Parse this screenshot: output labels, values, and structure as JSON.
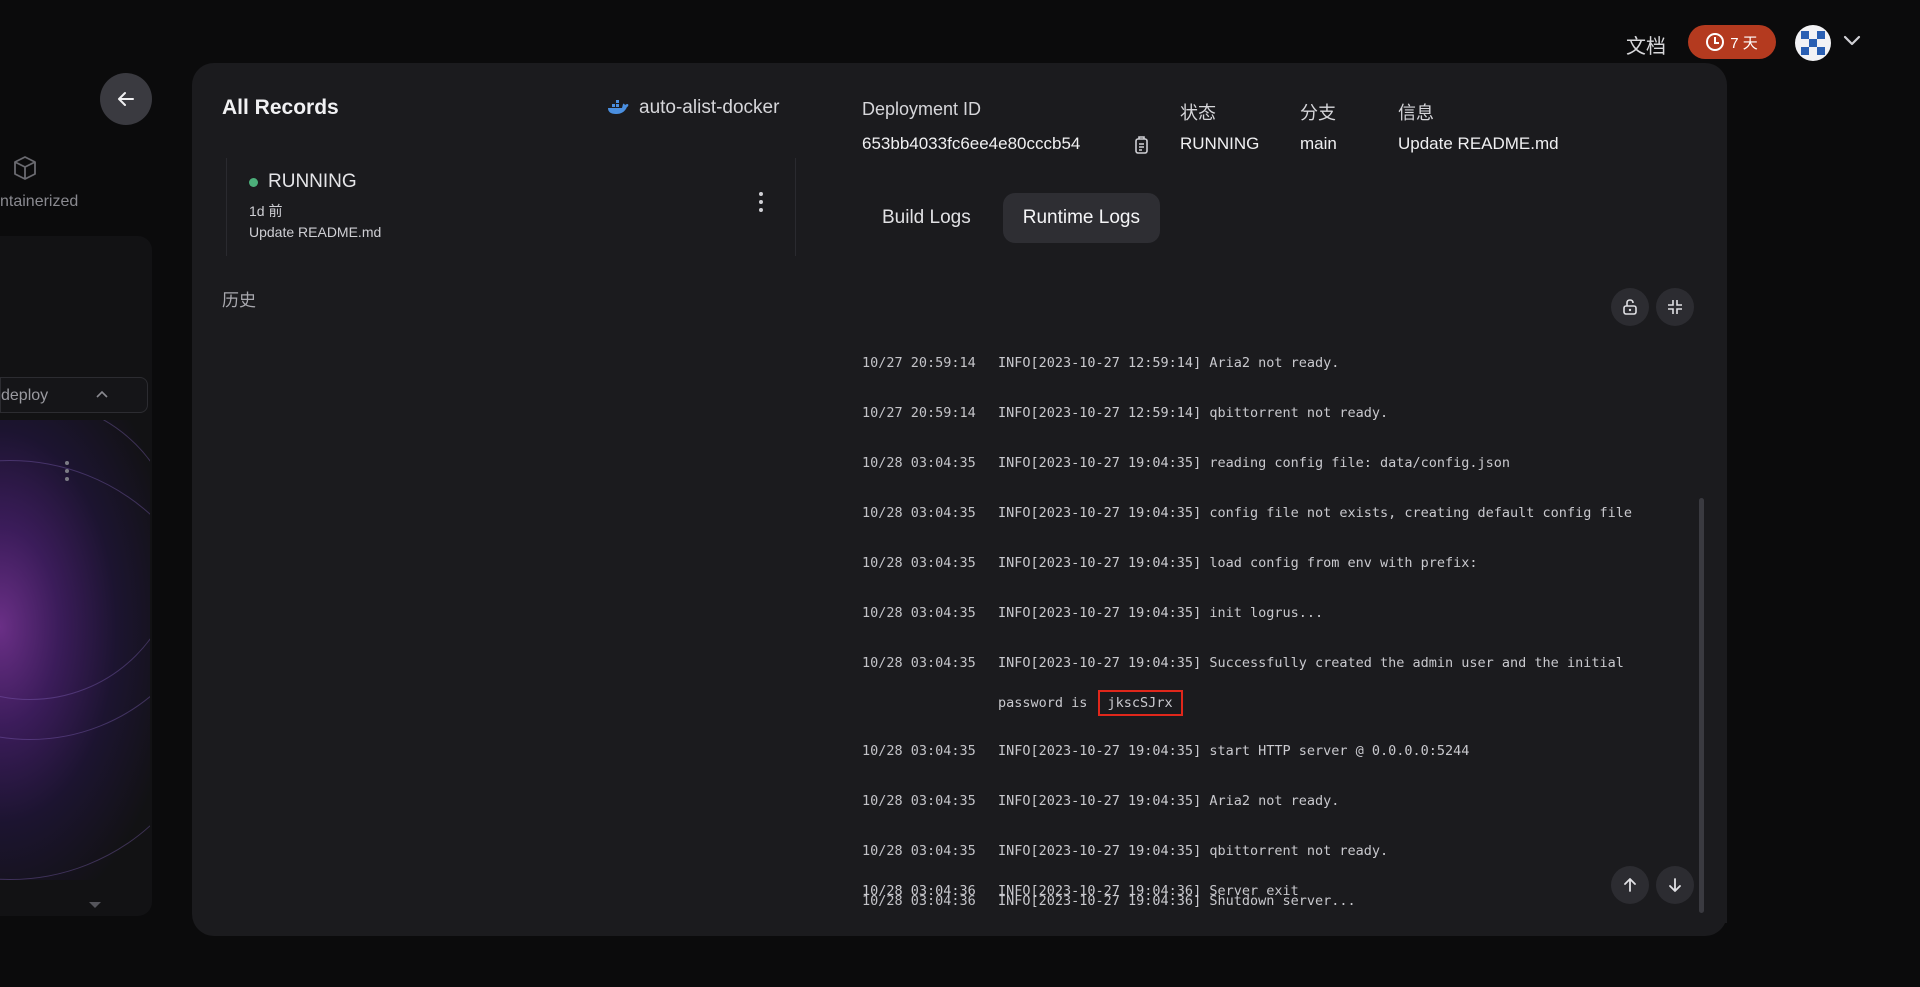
{
  "topbar": {
    "docs_label": "文档",
    "trial_label": "7 天"
  },
  "background": {
    "containerized_label": "ntainerized",
    "deploy_label": "deploy"
  },
  "records": {
    "title": "All Records",
    "project_name": "auto-alist-docker",
    "items": [
      {
        "status": "RUNNING",
        "time": "1d 前",
        "message": "Update README.md"
      }
    ],
    "history_label": "历史"
  },
  "deployment": {
    "id_label": "Deployment ID",
    "id_value": "653bb4033fc6ee4e80cccb54",
    "status_label": "状态",
    "status_value": "RUNNING",
    "branch_label": "分支",
    "branch_value": "main",
    "info_label": "信息",
    "info_value": "Update README.md"
  },
  "tabs": [
    {
      "label": "Build Logs",
      "active": false
    },
    {
      "label": "Runtime Logs",
      "active": true
    }
  ],
  "logs": [
    {
      "time": "10/27 20:59:14",
      "text": "INFO[2023-10-27 12:59:14] Aria2 not ready."
    },
    {
      "time": "10/27 20:59:14",
      "text": "INFO[2023-10-27 12:59:14] qbittorrent not ready."
    },
    {
      "time": "10/28 03:04:35",
      "text": "INFO[2023-10-27 19:04:35] reading config file: data/config.json"
    },
    {
      "time": "10/28 03:04:35",
      "text": "INFO[2023-10-27 19:04:35] config file not exists, creating default config file"
    },
    {
      "time": "10/28 03:04:35",
      "text": "INFO[2023-10-27 19:04:35] load config from env with prefix:"
    },
    {
      "time": "10/28 03:04:35",
      "text": "INFO[2023-10-27 19:04:35] init logrus..."
    },
    {
      "time": "10/28 03:04:35",
      "text": "INFO[2023-10-27 19:04:35] Successfully created the admin user and the initial",
      "wrap": "password is",
      "password": "jkscSJrx"
    },
    {
      "time": "10/28 03:04:35",
      "text": "INFO[2023-10-27 19:04:35] start HTTP server @ 0.0.0.0:5244"
    },
    {
      "time": "10/28 03:04:35",
      "text": "INFO[2023-10-27 19:04:35] Aria2 not ready."
    },
    {
      "time": "10/28 03:04:35",
      "text": "INFO[2023-10-27 19:04:35] qbittorrent not ready."
    },
    {
      "time": "10/28 03:04:36",
      "text": "INFO[2023-10-27 19:04:36] Shutdown server..."
    },
    {
      "time": "10/28 03:04:36",
      "text": "INFO[2023-10-27 19:04:36] Server exit"
    }
  ],
  "colors": {
    "running_dot": "#4caf7a",
    "trial_badge": "#b43a1f",
    "password_highlight": "#e0271b"
  }
}
